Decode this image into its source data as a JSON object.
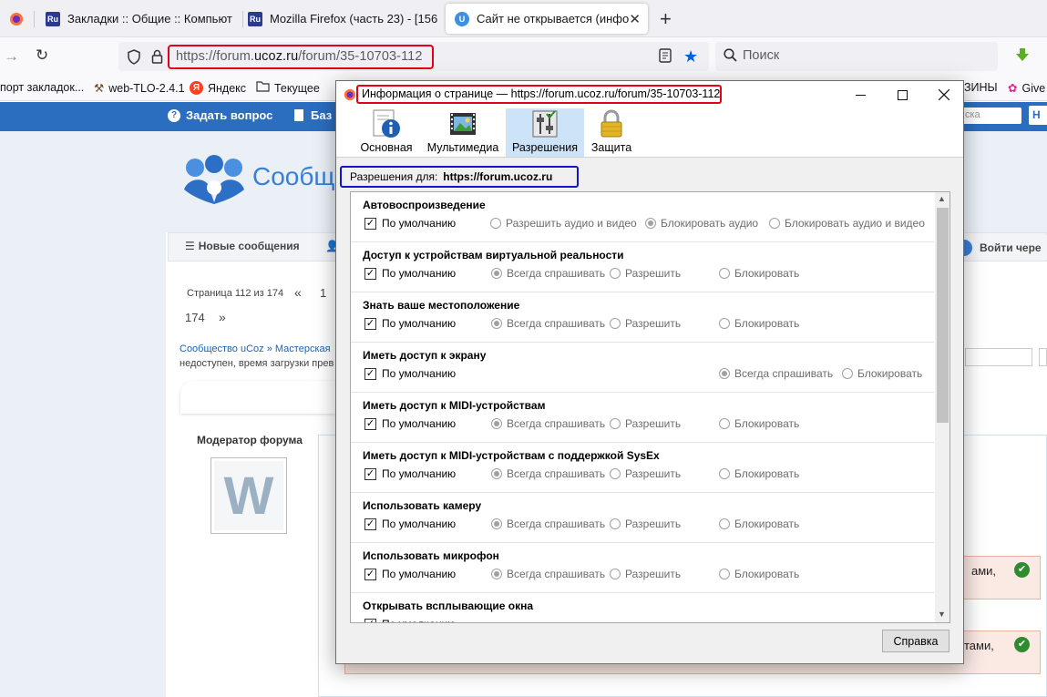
{
  "browser": {
    "tabs": [
      {
        "title": "",
        "active": false
      },
      {
        "title": "Закладки :: Общие :: Компьют",
        "favicon": "Ru",
        "active": false
      },
      {
        "title": "Mozilla Firefox (часть 23) - [156",
        "favicon": "Ru",
        "active": false
      },
      {
        "title": "Сайт не открывается (инфо о",
        "favicon": "U",
        "active": true
      }
    ],
    "new_tab_label": "+",
    "url": {
      "prefix": "https://forum.",
      "domain": "ucoz.ru",
      "path": "/forum/35-10703-112"
    },
    "search_placeholder": "Поиск",
    "bookmarks": [
      {
        "label": "порт закладок..."
      },
      {
        "label": "web-TLO-2.4.1"
      },
      {
        "label": "Яндекс"
      },
      {
        "label": "Текущее"
      },
      {
        "label": "ЗИНЫ"
      },
      {
        "label": "Give"
      }
    ]
  },
  "page": {
    "header_links": [
      "Задать вопрос",
      "Баз"
    ],
    "search_hint": "ска",
    "logo_text": "Сообщ",
    "menu": [
      "Новые сообщения"
    ],
    "login": "Войти чере",
    "pagination": {
      "text": "Страница 112 из 174",
      "prev": "«",
      "first": "1",
      "last": "174",
      "next": "»"
    },
    "breadcrumb": [
      "Сообщество uCoz",
      "»",
      "Мастерская"
    ],
    "subtitle": "недоступен, время загрузки прев",
    "moderator_label": "Модератор форума",
    "avatar_letter": "W",
    "post_tail": [
      "ами,",
      "тами,"
    ]
  },
  "dialog": {
    "title": "Информация о странице — https://forum.ucoz.ru/forum/35-10703-112",
    "tabs": [
      {
        "label": "Основная",
        "icon": "info-icon"
      },
      {
        "label": "Мультимедиа",
        "icon": "media-icon"
      },
      {
        "label": "Разрешения",
        "icon": "permissions-icon",
        "selected": true
      },
      {
        "label": "Защита",
        "icon": "lock-icon"
      }
    ],
    "permissions_for_label": "Разрешения для:",
    "permissions_for_site": "https://forum.ucoz.ru",
    "default_label": "По умолчанию",
    "permissions": [
      {
        "title": "Автовоспроизведение",
        "options": [
          "Разрешить аудио и видео",
          "Блокировать аудио",
          "Блокировать аудио и видео"
        ],
        "selected": 1
      },
      {
        "title": "Доступ к устройствам виртуальной реальности",
        "options": [
          "Всегда спрашивать",
          "Разрешить",
          "Блокировать"
        ],
        "selected": 0
      },
      {
        "title": "Знать ваше местоположение",
        "options": [
          "Всегда спрашивать",
          "Разрешить",
          "Блокировать"
        ],
        "selected": 0
      },
      {
        "title": "Иметь доступ к экрану",
        "options": [
          "Всегда спрашивать",
          "Блокировать"
        ],
        "selected": 0
      },
      {
        "title": "Иметь доступ к MIDI-устройствам",
        "options": [
          "Всегда спрашивать",
          "Разрешить",
          "Блокировать"
        ],
        "selected": 0
      },
      {
        "title": "Иметь доступ к MIDI-устройствам с поддержкой SysEx",
        "options": [
          "Всегда спрашивать",
          "Разрешить",
          "Блокировать"
        ],
        "selected": 0
      },
      {
        "title": "Использовать камеру",
        "options": [
          "Всегда спрашивать",
          "Разрешить",
          "Блокировать"
        ],
        "selected": 0
      },
      {
        "title": "Использовать микрофон",
        "options": [
          "Всегда спрашивать",
          "Разрешить",
          "Блокировать"
        ],
        "selected": 0
      },
      {
        "title": "Открывать всплывающие окна",
        "options": [],
        "selected": -1
      }
    ],
    "help_button": "Справка"
  },
  "colors": {
    "highlight_red": "#e2001a",
    "highlight_blue": "#1414c8",
    "site_blue": "#2b6dbf"
  }
}
